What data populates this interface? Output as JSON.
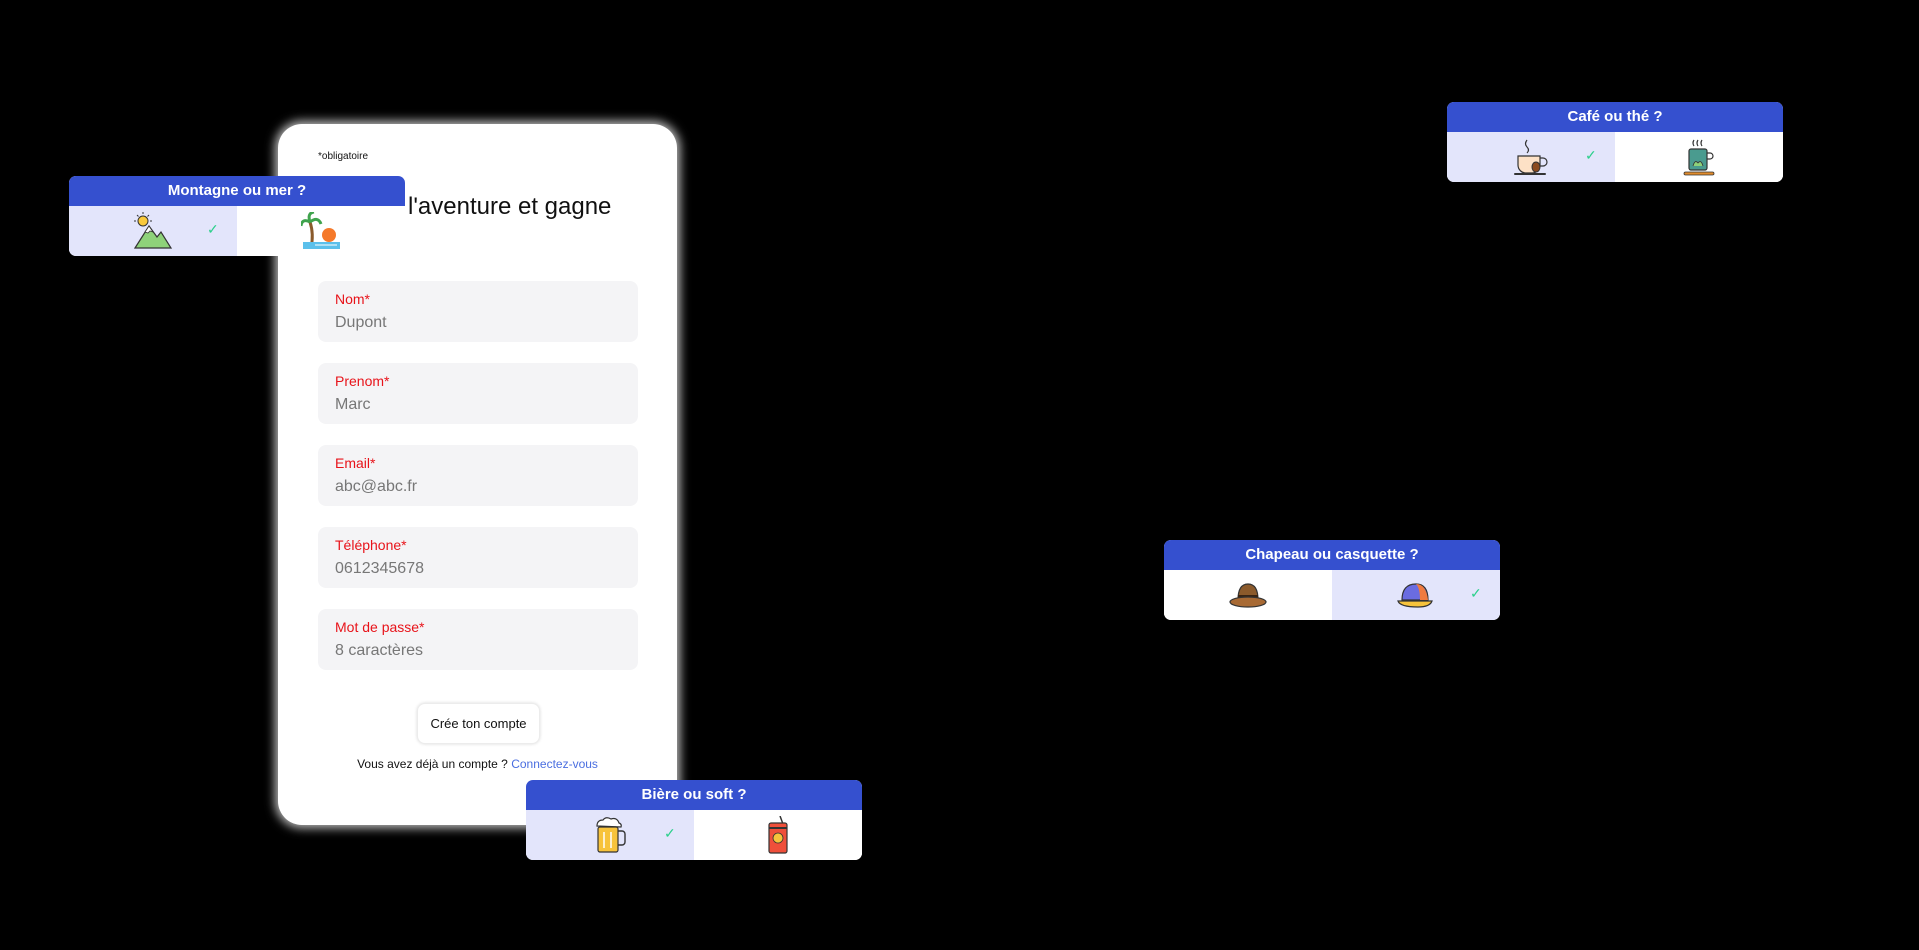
{
  "form": {
    "required_note": "*obligatoire",
    "headline": "l'aventure et gagne lité !",
    "fields": [
      {
        "label": "Nom*",
        "placeholder": "Dupont"
      },
      {
        "label": "Prenom*",
        "placeholder": "Marc"
      },
      {
        "label": "Email*",
        "placeholder": "abc@abc.fr"
      },
      {
        "label": "Téléphone*",
        "placeholder": "0612345678"
      },
      {
        "label": "Mot de passe*",
        "placeholder": "8 caractères"
      }
    ],
    "submit_label": "Crée ton compte",
    "login_prompt": "Vous avez déjà un compte ?",
    "login_link": "Connectez-vous"
  },
  "quizzes": {
    "mountain_sea": {
      "title": "Montagne ou mer ?",
      "options": [
        {
          "icon": "mountain-sun-icon",
          "selected": true
        },
        {
          "icon": "palm-beach-icon",
          "selected": false
        }
      ]
    },
    "coffee_tea": {
      "title": "Café ou thé ?",
      "options": [
        {
          "icon": "coffee-cup-icon",
          "selected": true
        },
        {
          "icon": "tea-glass-icon",
          "selected": false
        }
      ]
    },
    "hat_cap": {
      "title": "Chapeau ou casquette ?",
      "options": [
        {
          "icon": "hat-icon",
          "selected": false
        },
        {
          "icon": "cap-icon",
          "selected": true
        }
      ]
    },
    "beer_soft": {
      "title": "Bière ou soft ?",
      "options": [
        {
          "icon": "beer-mug-icon",
          "selected": true
        },
        {
          "icon": "soda-can-icon",
          "selected": false
        }
      ]
    }
  },
  "colors": {
    "accent": "#3550cf",
    "label_red": "#e8131a",
    "selected_bg": "#e3e5fb",
    "check_green": "#2bd08b",
    "link_blue": "#4a6ee0"
  }
}
